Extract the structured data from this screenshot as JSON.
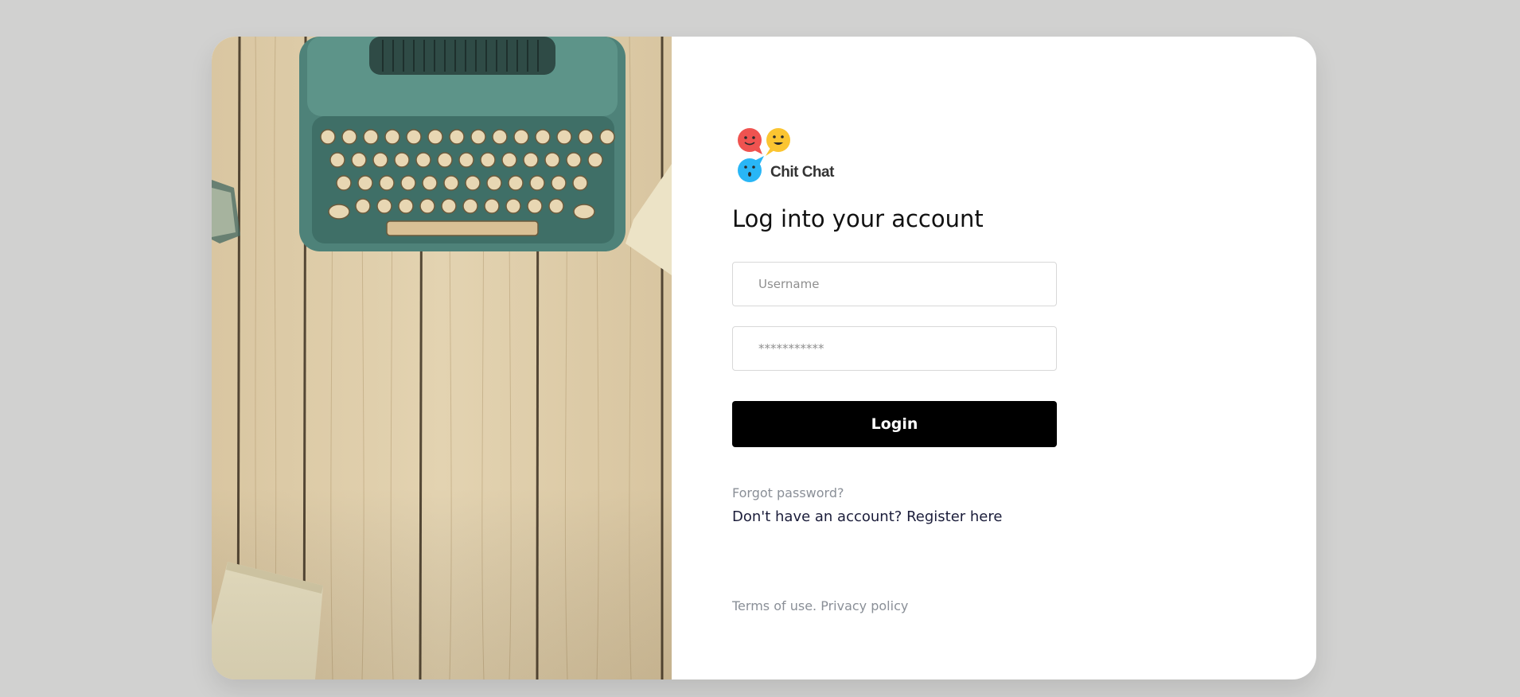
{
  "brand": {
    "name": "Chit Chat",
    "colors": {
      "red_bubble": "#ef5350",
      "yellow_bubble": "#fbc531",
      "blue_bubble": "#29b6f6"
    }
  },
  "hero_image": {
    "icon": "typewriter-photo"
  },
  "login": {
    "heading": "Log into your account",
    "username_placeholder": "Username",
    "password_placeholder": "***********",
    "submit_label": "Login",
    "forgot_label": "Forgot password?",
    "register_prompt": "Don't have an account?",
    "register_link": "Register here"
  },
  "footer": {
    "terms_label": "Terms of use.",
    "privacy_label": "Privacy policy"
  },
  "colors": {
    "page_background": "#d1d1d0",
    "button": "#000000",
    "muted_text": "#8a8f97",
    "link_text": "#1b1d3a"
  }
}
